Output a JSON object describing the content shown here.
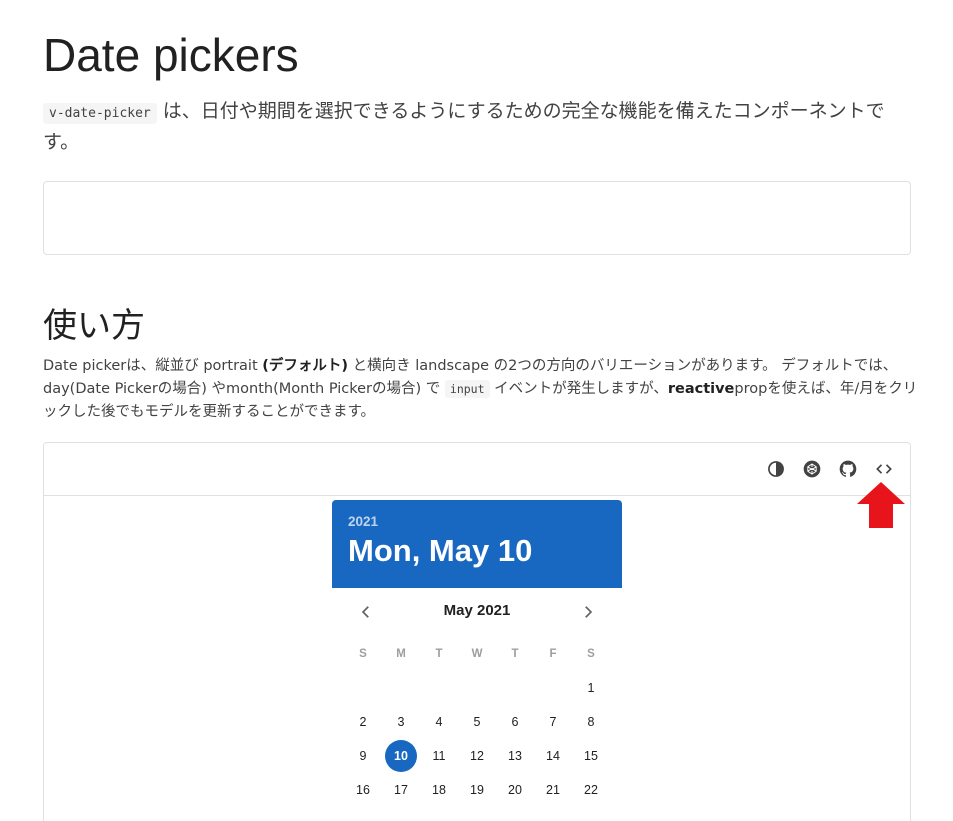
{
  "page": {
    "title": "Date pickers",
    "intro_code": "v-date-picker",
    "intro_text": " は、日付や期間を選択できるようにするための完全な機能を備えたコンポーネントです。"
  },
  "usage": {
    "title": "使い方",
    "desc_1": "Date pickerは、縦並び portrait ",
    "desc_bold_1": "(デフォルト)",
    "desc_2": " と横向き landscape の2つの方向のバリエーションがあります。 デフォルトでは、day(Date Pickerの場合) やmonth(Month Pickerの場合) で ",
    "desc_code": "input",
    "desc_3": " イベントが発生しますが、",
    "desc_bold_2": "reactive",
    "desc_4": "propを使えば、年/月をクリックした後でもモデルを更新することができます。"
  },
  "toolbar": {
    "icons": [
      "invert-colors-icon",
      "codepen-icon",
      "github-icon",
      "code-icon"
    ]
  },
  "colors": {
    "accent": "#1867c0",
    "arrow": "#e8141b"
  },
  "date_picker": {
    "year": "2021",
    "date": "Mon, May 10",
    "month_label": "May 2021",
    "weekdays": [
      "S",
      "M",
      "T",
      "W",
      "T",
      "F",
      "S"
    ],
    "weeks": [
      [
        "",
        "",
        "",
        "",
        "",
        "",
        "1"
      ],
      [
        "2",
        "3",
        "4",
        "5",
        "6",
        "7",
        "8"
      ],
      [
        "9",
        "10",
        "11",
        "12",
        "13",
        "14",
        "15"
      ],
      [
        "16",
        "17",
        "18",
        "19",
        "20",
        "21",
        "22"
      ]
    ],
    "selected": "10"
  }
}
